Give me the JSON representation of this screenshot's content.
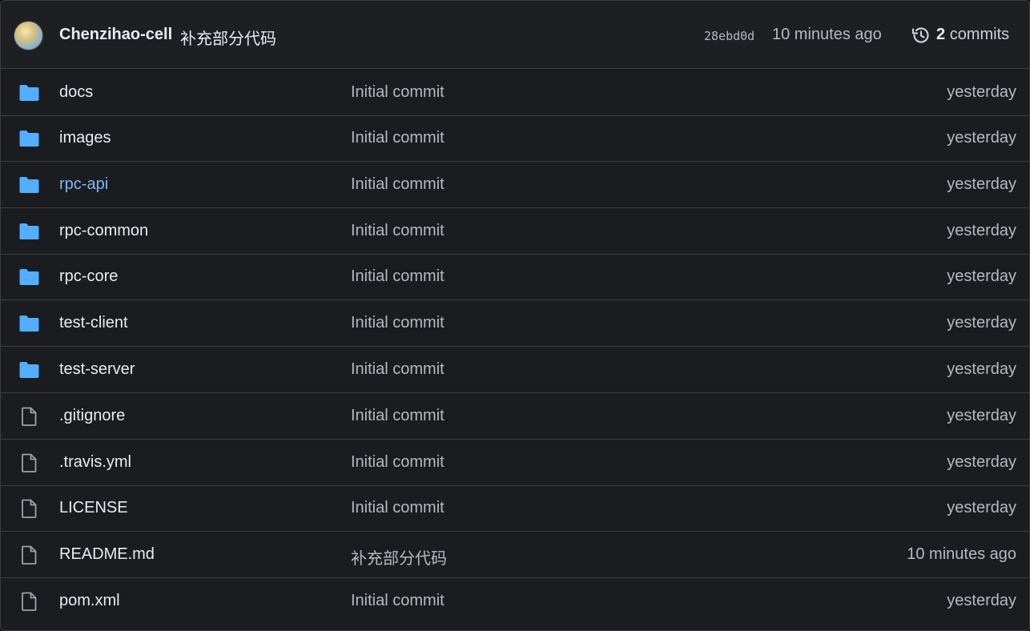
{
  "header": {
    "author": "Chenzihao-cell",
    "commit_message": "补充部分代码",
    "sha": "28ebd0d",
    "time": "10 minutes ago",
    "commit_count": "2",
    "commits_label": "commits",
    "history_icon": "history-icon"
  },
  "colors": {
    "folder": "#54aeff",
    "link": "#79b8ff",
    "background": "#1b1c1f",
    "border": "#3a3d42"
  },
  "files": [
    {
      "type": "folder",
      "name": "docs",
      "message": "Initial commit",
      "age": "yesterday"
    },
    {
      "type": "folder",
      "name": "images",
      "message": "Initial commit",
      "age": "yesterday"
    },
    {
      "type": "folder",
      "name": "rpc-api",
      "message": "Initial commit",
      "age": "yesterday",
      "hovered": true
    },
    {
      "type": "folder",
      "name": "rpc-common",
      "message": "Initial commit",
      "age": "yesterday"
    },
    {
      "type": "folder",
      "name": "rpc-core",
      "message": "Initial commit",
      "age": "yesterday"
    },
    {
      "type": "folder",
      "name": "test-client",
      "message": "Initial commit",
      "age": "yesterday"
    },
    {
      "type": "folder",
      "name": "test-server",
      "message": "Initial commit",
      "age": "yesterday"
    },
    {
      "type": "file",
      "name": ".gitignore",
      "message": "Initial commit",
      "age": "yesterday"
    },
    {
      "type": "file",
      "name": ".travis.yml",
      "message": "Initial commit",
      "age": "yesterday"
    },
    {
      "type": "file",
      "name": "LICENSE",
      "message": "Initial commit",
      "age": "yesterday"
    },
    {
      "type": "file",
      "name": "README.md",
      "message": "补充部分代码",
      "age": "10 minutes ago"
    },
    {
      "type": "file",
      "name": "pom.xml",
      "message": "Initial commit",
      "age": "yesterday"
    }
  ]
}
